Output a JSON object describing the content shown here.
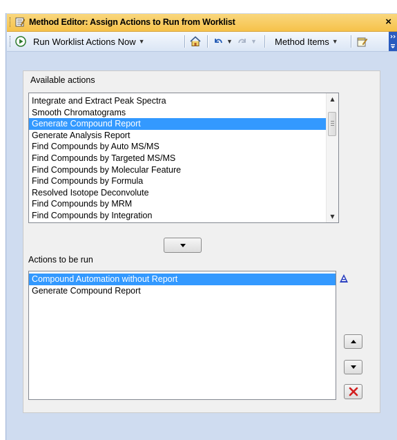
{
  "window": {
    "title": "Method Editor: Assign Actions to Run from Worklist",
    "close_glyph": "×"
  },
  "toolbar": {
    "run_label": "Run Worklist Actions Now",
    "method_items_label": "Method Items",
    "icons": [
      "play-icon",
      "dropdown-arrow-icon",
      "home-icon",
      "undo-icon",
      "redo-icon",
      "dropdown-arrow-icon",
      "notes-icon",
      "overflow-icon"
    ]
  },
  "available": {
    "label": "Available actions",
    "items": [
      {
        "label": "Integrate and Extract Peak Spectra",
        "selected": false
      },
      {
        "label": "Smooth Chromatograms",
        "selected": false
      },
      {
        "label": "Generate Compound Report",
        "selected": true
      },
      {
        "label": "Generate Analysis Report",
        "selected": false
      },
      {
        "label": "Find Compounds by Auto MS/MS",
        "selected": false
      },
      {
        "label": "Find Compounds by Targeted MS/MS",
        "selected": false
      },
      {
        "label": "Find Compounds by Molecular Feature",
        "selected": false
      },
      {
        "label": "Find Compounds by Formula",
        "selected": false
      },
      {
        "label": "Resolved Isotope Deconvolute",
        "selected": false
      },
      {
        "label": "Find Compounds by MRM",
        "selected": false
      },
      {
        "label": "Find Compounds by Integration",
        "selected": false
      }
    ]
  },
  "to_run": {
    "label": "Actions to be run",
    "items": [
      {
        "label": "Compound Automation without Report",
        "selected": true
      },
      {
        "label": "Generate Compound Report",
        "selected": false
      }
    ]
  },
  "colors": {
    "selection": "#3399ff",
    "title_bar": "#f6c24a",
    "delete_x": "#d21f1f"
  }
}
